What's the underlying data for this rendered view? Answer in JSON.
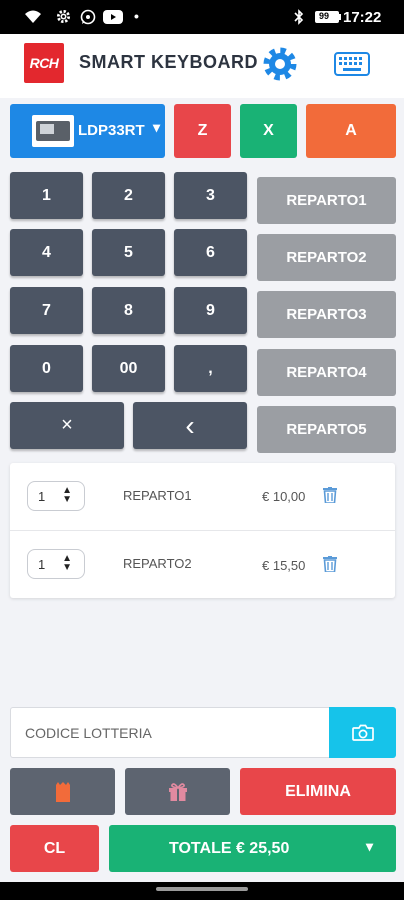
{
  "status_bar": {
    "time": "17:22",
    "dot": "•",
    "battery": "99"
  },
  "header": {
    "logo_text": "RCH",
    "title": "SMART KEYBOARD"
  },
  "device": {
    "name": "LDP33RT",
    "caret": "▾"
  },
  "mode_buttons": {
    "z": "Z",
    "x": "X",
    "a": "A"
  },
  "keypad": {
    "keys": [
      "1",
      "2",
      "3",
      "4",
      "5",
      "6",
      "7",
      "8",
      "9",
      "0",
      "00",
      ","
    ],
    "clear_symbol": "×",
    "back_symbol": "‹"
  },
  "departments": [
    "REPARTO1",
    "REPARTO2",
    "REPARTO3",
    "REPARTO4",
    "REPARTO5"
  ],
  "items": [
    {
      "qty": "1",
      "name": "REPARTO1",
      "price": "€ 10,00"
    },
    {
      "qty": "1",
      "name": "REPARTO2",
      "price": "€ 15,50"
    }
  ],
  "lottery": {
    "placeholder": "CODICE LOTTERIA"
  },
  "actions": {
    "elimina": "ELIMINA",
    "cl": "CL",
    "totale": "TOTALE € 25,50",
    "totale_caret": "▾"
  },
  "colors": {
    "blue": "#1e88e5",
    "red": "#e8464a",
    "green": "#19b275",
    "orange": "#f26b3a",
    "cyan": "#16c3ea",
    "key_dark": "#4c5564",
    "key_grey": "#9b9ea3",
    "slate": "#5d6470"
  }
}
